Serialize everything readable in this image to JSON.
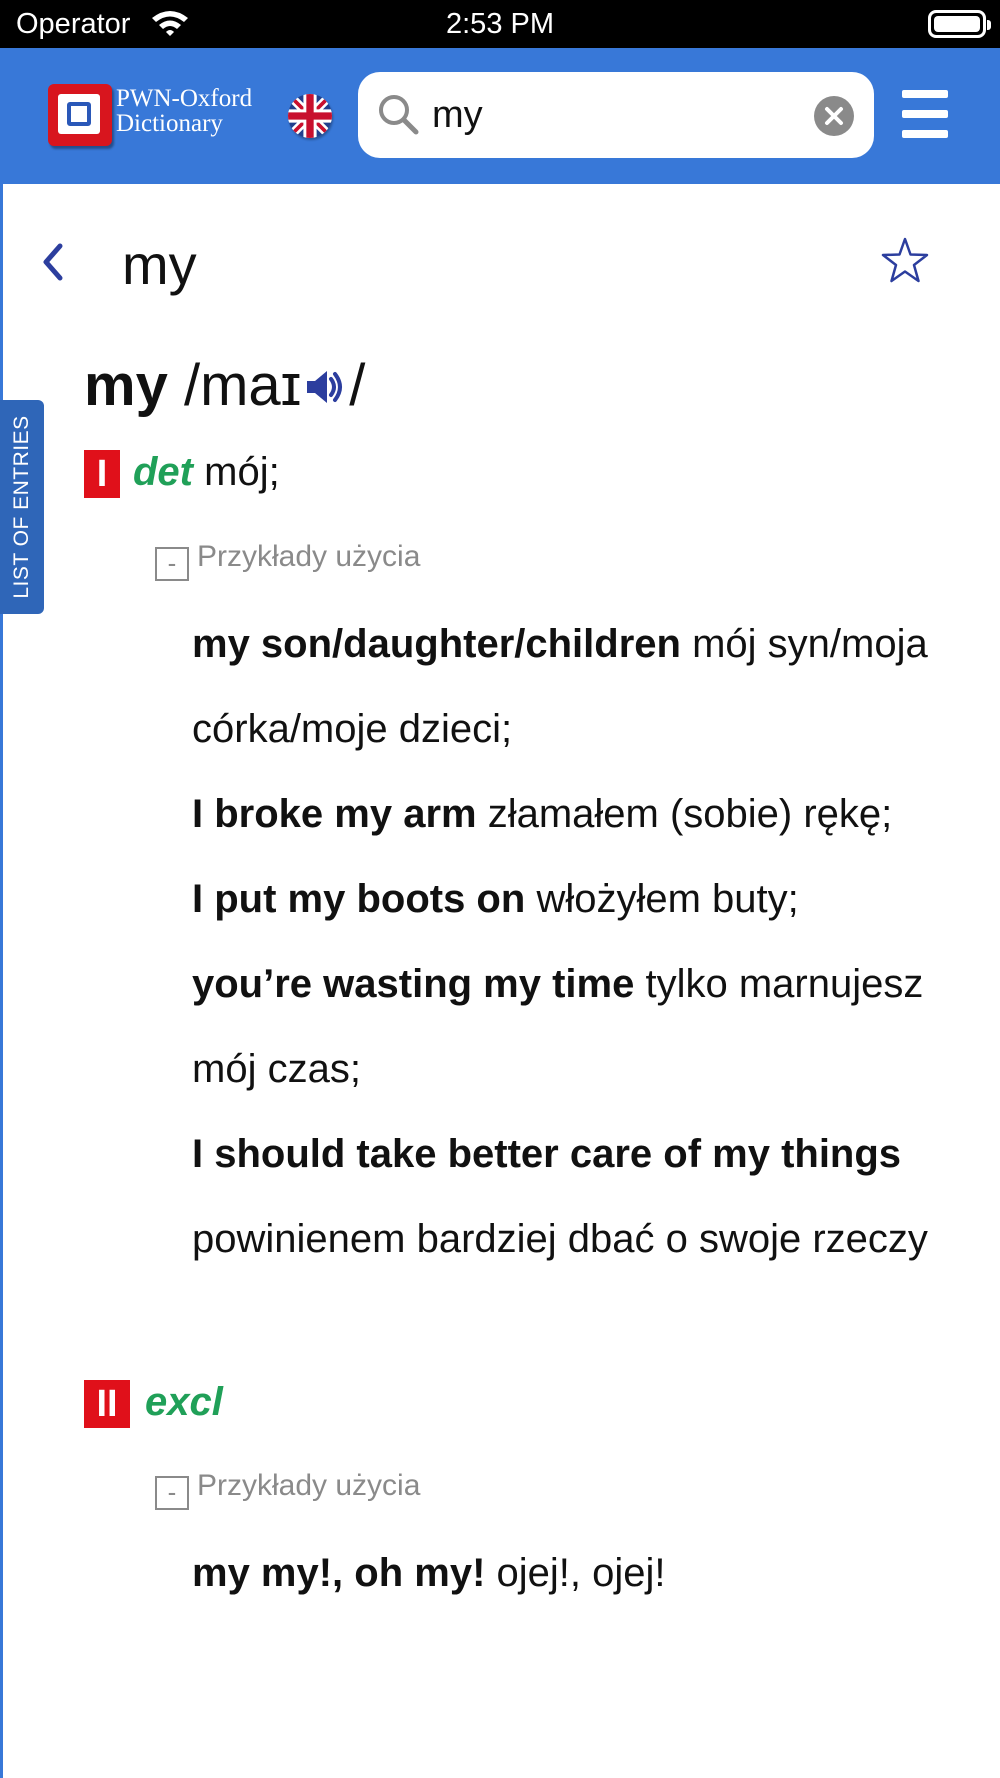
{
  "status_bar": {
    "carrier": "Operator",
    "time": "2:53 PM"
  },
  "header": {
    "logo_line1": "PWN-Oxford",
    "logo_line2": "Dictionary",
    "search_value": "my"
  },
  "entry": {
    "title": "my",
    "side_tab_label": "LIST OF ENTRIES",
    "headword": "my",
    "pron_open": "/maɪ",
    "pron_close": "/",
    "senses": [
      {
        "marker": "I",
        "pos": "det",
        "translation": "mój;",
        "examples_toggle": "Przykłady użycia",
        "examples": [
          {
            "source": "my son/daughter/children",
            "target": "mój syn/moja córka/moje dzieci;"
          },
          {
            "source": "I broke my arm",
            "target": "złamałem (sobie) rękę;"
          },
          {
            "source": "I put my boots on",
            "target": "włożyłem buty;"
          },
          {
            "source": "you’re wasting my time",
            "target": "tylko marnujesz mój czas;"
          },
          {
            "source": "I should take better care of my things",
            "target": "powinienem bardziej dbać o swoje rzeczy"
          }
        ]
      },
      {
        "marker": "II",
        "pos": "excl",
        "translation": "",
        "examples_toggle": "Przykłady użycia",
        "examples": [
          {
            "source": "my my!, oh my!",
            "target": "ojej!, ojej!"
          }
        ]
      }
    ]
  },
  "colors": {
    "header_blue": "#3878d8",
    "side_tab_blue": "#2f66b8",
    "sense_red": "#e0101a",
    "pos_green": "#20a058",
    "icon_navy": "#2c3e9e"
  },
  "icons": {
    "wifi": "wifi-icon",
    "battery": "battery-icon",
    "search": "search-icon",
    "clear": "clear-icon",
    "menu": "hamburger-menu-icon",
    "back": "chevron-left-icon",
    "favorite": "star-outline-icon",
    "audio": "speaker-icon",
    "flag": "uk-flag-icon"
  }
}
